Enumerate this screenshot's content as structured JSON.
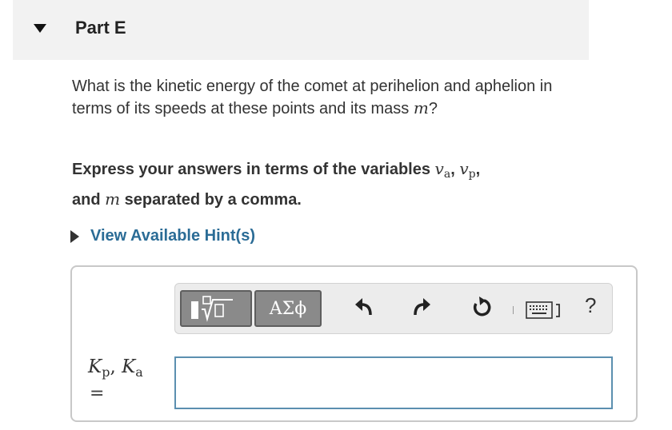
{
  "part": {
    "title": "Part E",
    "expanded": true
  },
  "question": {
    "text": "What is the kinetic energy of the comet at perihelion and aphelion in terms of its speeds at these points and its mass",
    "var": "m",
    "end": "?"
  },
  "instruction": {
    "text": "Express your answers in terms of the variables",
    "v1": "v",
    "v1_sub": "a",
    "comma1": ",",
    "v2": "v",
    "v2_sub": "p",
    "comma2": ",",
    "and": "and",
    "v3": "m",
    "rest": "separated by a comma."
  },
  "hint": {
    "label": "View Available Hint(s)"
  },
  "toolbar": {
    "greek_label": "ΑΣϕ",
    "help_label": "?",
    "icons": [
      "templates-icon",
      "undo-icon",
      "redo-icon",
      "reset-icon",
      "keyboard-icon"
    ]
  },
  "answer": {
    "lhs_k1": "K",
    "lhs_k1_sub": "p",
    "lhs_sep": ",",
    "lhs_k2": "K",
    "lhs_k2_sub": "a",
    "equals": "=",
    "value": ""
  },
  "colors": {
    "link": "#2b6c96",
    "input_border": "#5b8fb0",
    "header_bg": "#f2f2f2"
  }
}
